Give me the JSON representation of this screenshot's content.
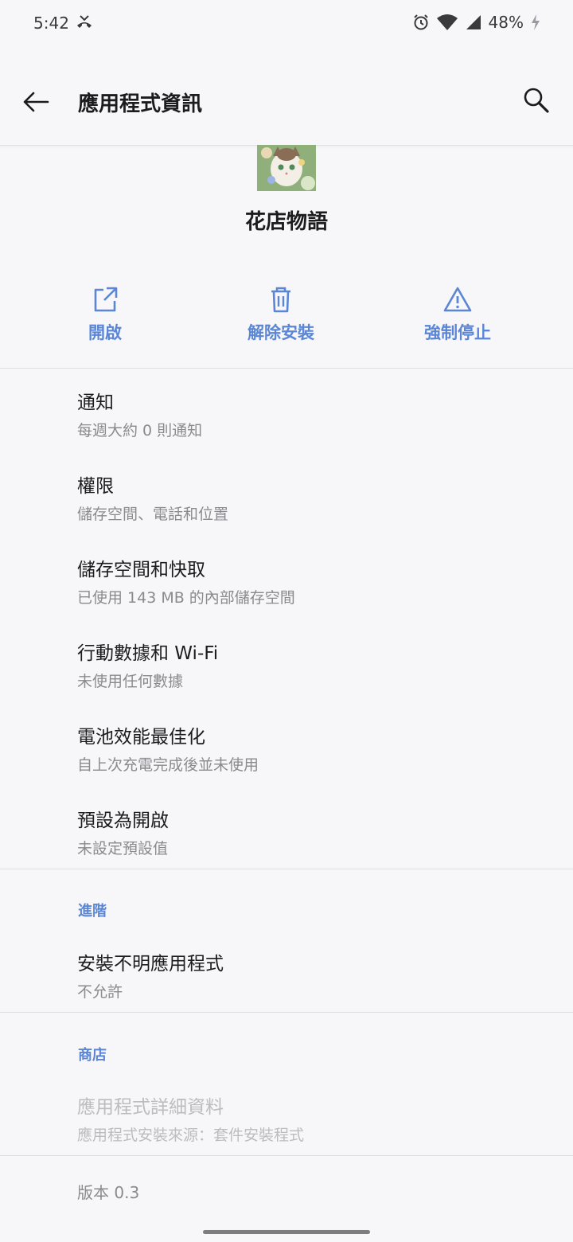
{
  "status_bar": {
    "time": "5:42",
    "battery": "48%"
  },
  "header": {
    "title": "應用程式資訊"
  },
  "app": {
    "name": "花店物語"
  },
  "actions": [
    {
      "label": "開啟",
      "icon": "open-external-icon"
    },
    {
      "label": "解除安裝",
      "icon": "trash-icon"
    },
    {
      "label": "強制停止",
      "icon": "warning-icon"
    }
  ],
  "settings": [
    {
      "title": "通知",
      "subtitle": "每週大約 0 則通知"
    },
    {
      "title": "權限",
      "subtitle": "儲存空間、電話和位置"
    },
    {
      "title": "儲存空間和快取",
      "subtitle": "已使用 143 MB 的內部儲存空間"
    },
    {
      "title": "行動數據和 Wi-Fi",
      "subtitle": "未使用任何數據"
    },
    {
      "title": "電池效能最佳化",
      "subtitle": "自上次充電完成後並未使用"
    },
    {
      "title": "預設為開啟",
      "subtitle": "未設定預設值"
    }
  ],
  "advanced": {
    "header": "進階",
    "item": {
      "title": "安裝不明應用程式",
      "subtitle": "不允許"
    }
  },
  "store": {
    "header": "商店",
    "item": {
      "title": "應用程式詳細資料",
      "subtitle": "應用程式安裝來源：套件安裝程式"
    }
  },
  "version": "版本 0.3",
  "colors": {
    "accent": "#5b86d6",
    "background": "#f7f7f9"
  }
}
